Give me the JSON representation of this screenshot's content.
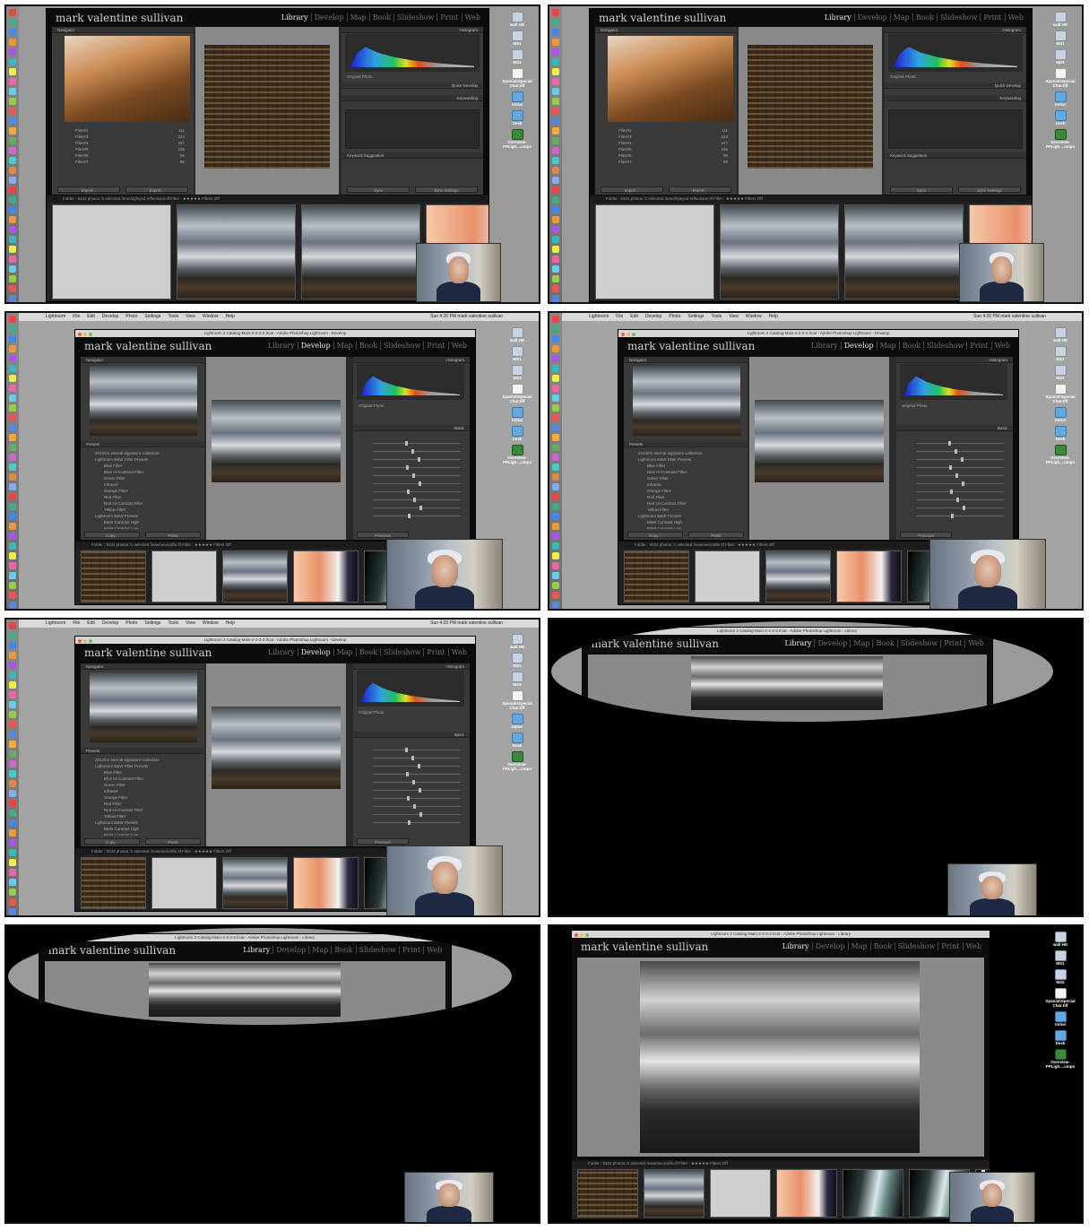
{
  "photographer_name": "mark valentine sullivan",
  "modules": [
    "Library",
    "Develop",
    "Map",
    "Book",
    "Slideshow",
    "Print",
    "Web"
  ],
  "window_title_develop": "Lightroom 2 Catalog-Main-2-2-2-2.lrcat - Adobe Photoshop Lightroom - Develop",
  "window_title_library": "Lightroom 2 Catalog-Main-2-2-2-2.lrcat - Adobe Photoshop Lightroom - Library",
  "mac_menu": [
    "Lightroom",
    "File",
    "Edit",
    "Develop",
    "Photo",
    "Settings",
    "Tools",
    "View",
    "Window",
    "Help"
  ],
  "mac_menu_right": "Sun 4:20 PM   mark valentine sullivan",
  "panels": {
    "navigator": "Navigator",
    "histogram": "Histogram",
    "presets": "Presets",
    "quick_develop": "Quick Develop",
    "keywording": "Keywording",
    "keyword_suggestions": "Keyword Suggestion",
    "basic": "Basic",
    "catalog": "Catalog",
    "folders": "Folders",
    "original_photo": "Original Photo"
  },
  "folders": [
    {
      "name": "Files#2",
      "count": "111"
    },
    {
      "name": "Files#3",
      "count": "224"
    },
    {
      "name": "Files#4",
      "count": "247"
    },
    {
      "name": "Files#5",
      "count": "156"
    },
    {
      "name": "Files#6",
      "count": "96"
    },
    {
      "name": "Files#7",
      "count": "80"
    }
  ],
  "presets": [
    "2012/01 eternal-signature-collection",
    "Lightroom B&W Filter Presets",
    "Blue Filter",
    "Blue Hi-Contrast Filter",
    "Green Filter",
    "Infrared",
    "Orange Filter",
    "Red Filter",
    "Red Hi-Contrast Filter",
    "Yellow Filter",
    "Lightroom B&W Presets",
    "B&W Contrast High",
    "B&W Contrast Low"
  ],
  "buttons": {
    "import": "Import...",
    "export": "Export...",
    "copy": "Copy...",
    "paste": "Paste",
    "previous": "Previous",
    "sync": "Sync",
    "sync_settings": "Sync Settings"
  },
  "filmstrip": {
    "folder_label": "Folder :",
    "count_library": "9322 photos /1 selected /amerityleyed reflections.tif",
    "count_develop": "9322 photos /1 selected /newmexicolife.tif",
    "filter_label": "Filter :",
    "filters_off": "Filters Off"
  },
  "desktop_icons": [
    {
      "label": "wall HD",
      "type": "drive"
    },
    {
      "label": "MS1",
      "type": "drive"
    },
    {
      "label": "MS2",
      "type": "drive"
    },
    {
      "label": "SpanishSpecial Char.tiff",
      "type": "doc"
    },
    {
      "label": "Initial",
      "type": "folder"
    },
    {
      "label": "Desk",
      "type": "folder"
    },
    {
      "label": "Overview-PPLigh....cmpo",
      "type": "green"
    }
  ],
  "colors": {
    "lr_background": "#0c0c0c",
    "active_module": "#e8e8e8",
    "inactive_module": "#6f6f6f"
  }
}
